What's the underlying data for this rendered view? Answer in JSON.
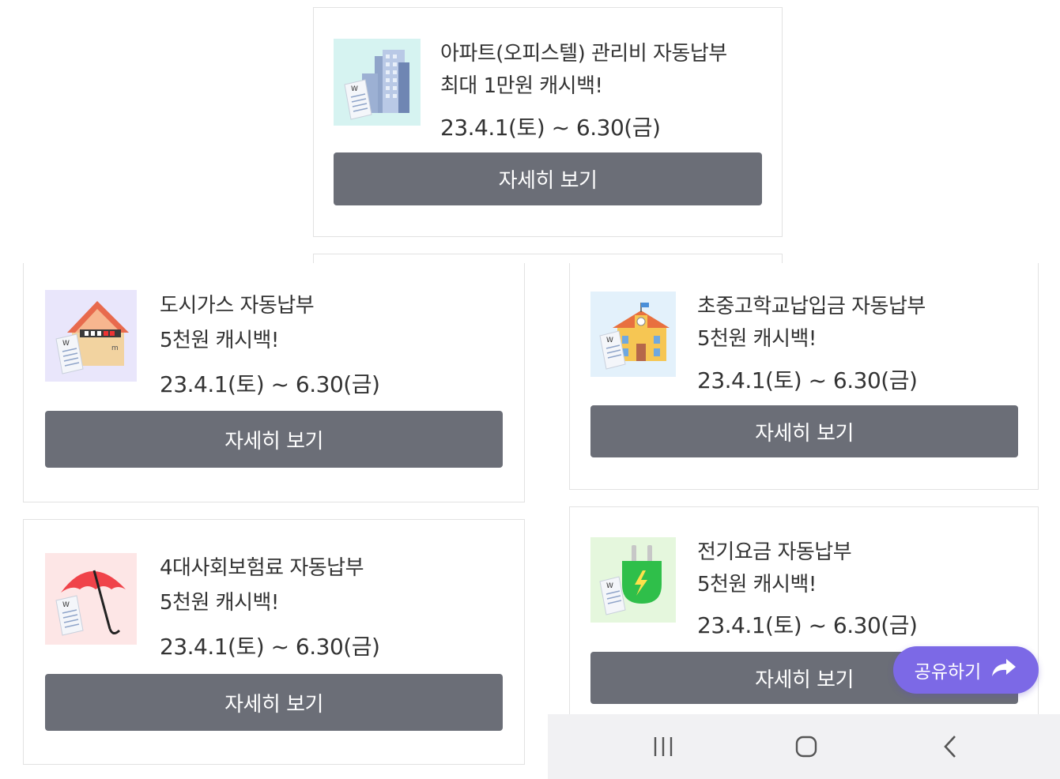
{
  "cards": [
    {
      "id": "apartment",
      "title_line1": "아파트(오피스텔) 관리비 자동납부",
      "title_line2": "최대 1만원 캐시백!",
      "date": "23.4.1(토) ~ 6.30(금)",
      "button": "자세히 보기",
      "thumb_icon": "apartment-building-icon",
      "thumb_bg": "#d6f3f1"
    },
    {
      "id": "gas",
      "title_line1": "도시가스 자동납부",
      "title_line2": "5천원 캐시백!",
      "date": "23.4.1(토) ~ 6.30(금)",
      "button": "자세히 보기",
      "thumb_icon": "house-gas-meter-icon",
      "thumb_bg": "#e9e6fb"
    },
    {
      "id": "school",
      "title_line1": "초중고학교납입금 자동납부",
      "title_line2": "5천원 캐시백!",
      "date": "23.4.1(토) ~ 6.30(금)",
      "button": "자세히 보기",
      "thumb_icon": "school-building-icon",
      "thumb_bg": "#e3f1fb"
    },
    {
      "id": "insurance",
      "title_line1": "4대사회보험료 자동납부",
      "title_line2": "5천원 캐시백!",
      "date": "23.4.1(토) ~ 6.30(금)",
      "button": "자세히 보기",
      "thumb_icon": "umbrella-icon",
      "thumb_bg": "#fde6e6"
    },
    {
      "id": "electric",
      "title_line1": "전기요금 자동납부",
      "title_line2": "5천원 캐시백!",
      "date": "23.4.1(토) ~ 6.30(금)",
      "button": "자세히 보기",
      "thumb_icon": "electric-plug-icon",
      "thumb_bg": "#e5f7dd"
    }
  ],
  "share": {
    "label": "공유하기",
    "icon": "share-arrow-icon",
    "color": "#7c69e6"
  },
  "navbar": {
    "recent_icon": "recent-apps-icon",
    "home_icon": "home-icon",
    "back_icon": "back-icon"
  },
  "colors": {
    "button_bg": "#6b6e77",
    "card_border": "#e2e2e2"
  }
}
